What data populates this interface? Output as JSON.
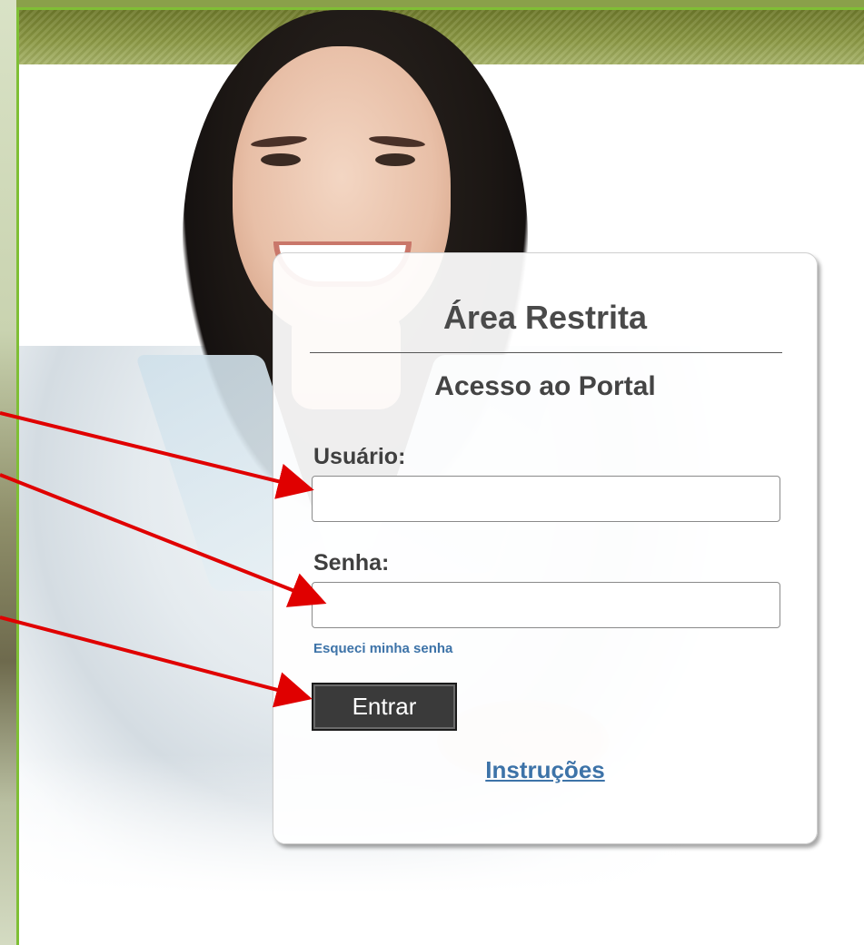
{
  "login_box": {
    "title": "Área Restrita",
    "subtitle": "Acesso ao Portal",
    "username_label": "Usuário:",
    "username_value": "",
    "password_label": "Senha:",
    "password_value": "",
    "forgot_link": "Esqueci minha senha",
    "submit_label": "Entrar",
    "instructions_link": "Instruções"
  },
  "colors": {
    "frame_green": "#7fbf35",
    "header_olive": "#7d8a38",
    "link_blue": "#3d73a8",
    "button_dark": "#3a3a3a",
    "arrow_red": "#e00000"
  },
  "annotations": {
    "arrow_targets": [
      "username-field",
      "password-field",
      "submit-button"
    ]
  }
}
